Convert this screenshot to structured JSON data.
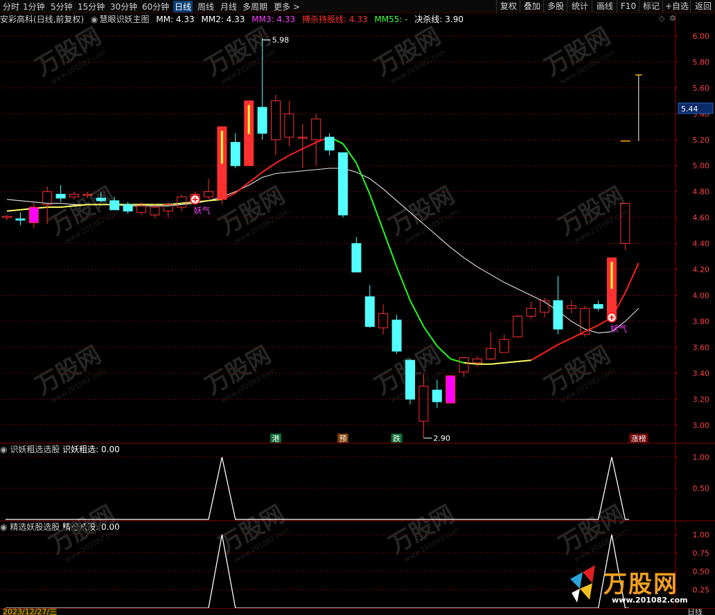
{
  "toolbar": {
    "periods": [
      "分时",
      "1分钟",
      "5分钟",
      "15分钟",
      "30分钟",
      "60分钟",
      "日线",
      "周线",
      "月线",
      "多周期",
      "更多"
    ],
    "active_period": "日线",
    "more_arrow": ">",
    "right_buttons": [
      "复权",
      "叠加",
      "多股",
      "统计",
      "画线",
      "F10",
      "标记",
      "+自选",
      "返回"
    ]
  },
  "info": {
    "stock": "安彩高科",
    "mode": "(日线,前复权)",
    "indicator": "慧眼识妖主图",
    "mm": "MM: 4.33",
    "mm2": "MM2: 4.33",
    "mm3": "MM3: 4.33",
    "hold": "搏杀持股线: 4.33",
    "mm55": "MM55: -",
    "kill": "决杀线: 3.90"
  },
  "colors": {
    "up": "#ff3030",
    "down": "#54ffff",
    "magenta": "#ff00ff",
    "grid": "#7a0000",
    "axis": "#8b0000"
  },
  "chart_data": [
    {
      "type": "candlestick",
      "title": "慧眼识妖主图",
      "ylim": [
        2.86,
        6.08
      ],
      "yticks": [
        "6.00",
        "5.80",
        "5.60",
        "5.40",
        "5.20",
        "5.00",
        "4.80",
        "4.60",
        "4.40",
        "4.20",
        "4.00",
        "3.80",
        "3.60",
        "3.40",
        "3.20",
        "3.00"
      ],
      "current_price": "5.44",
      "candles": [
        {
          "o": 4.6,
          "h": 4.62,
          "l": 4.58,
          "c": 4.61,
          "t": "up"
        },
        {
          "o": 4.59,
          "h": 4.64,
          "l": 4.54,
          "c": 4.58,
          "t": "down"
        },
        {
          "o": 4.56,
          "h": 4.72,
          "l": 4.52,
          "c": 4.68,
          "t": "mag"
        },
        {
          "o": 4.7,
          "h": 4.84,
          "l": 4.55,
          "c": 4.8,
          "t": "up"
        },
        {
          "o": 4.75,
          "h": 4.85,
          "l": 4.72,
          "c": 4.78,
          "t": "down"
        },
        {
          "o": 4.76,
          "h": 4.8,
          "l": 4.74,
          "c": 4.78,
          "t": "up"
        },
        {
          "o": 4.77,
          "h": 4.8,
          "l": 4.75,
          "c": 4.78,
          "t": "up"
        },
        {
          "o": 4.75,
          "h": 4.8,
          "l": 4.72,
          "c": 4.73,
          "t": "down"
        },
        {
          "o": 4.73,
          "h": 4.76,
          "l": 4.68,
          "c": 4.66,
          "t": "down"
        },
        {
          "o": 4.7,
          "h": 4.72,
          "l": 4.63,
          "c": 4.65,
          "t": "down"
        },
        {
          "o": 4.64,
          "h": 4.72,
          "l": 4.62,
          "c": 4.69,
          "t": "up"
        },
        {
          "o": 4.62,
          "h": 4.7,
          "l": 4.6,
          "c": 4.68,
          "t": "up"
        },
        {
          "o": 4.65,
          "h": 4.72,
          "l": 4.6,
          "c": 4.7,
          "t": "up"
        },
        {
          "o": 4.68,
          "h": 4.78,
          "l": 4.65,
          "c": 4.76,
          "t": "up"
        },
        {
          "o": 4.73,
          "h": 4.8,
          "l": 4.7,
          "c": 4.78,
          "t": "up"
        },
        {
          "o": 4.76,
          "h": 4.9,
          "l": 4.74,
          "c": 4.8,
          "t": "up"
        },
        {
          "o": 4.74,
          "h": 5.3,
          "l": 4.7,
          "c": 5.3,
          "t": "up"
        },
        {
          "o": 5.18,
          "h": 5.25,
          "l": 4.98,
          "c": 5.0,
          "t": "down"
        },
        {
          "o": 5.0,
          "h": 5.5,
          "l": 5.0,
          "c": 5.5,
          "t": "up"
        },
        {
          "o": 5.25,
          "h": 5.98,
          "l": 5.2,
          "c": 5.45,
          "t": "down"
        },
        {
          "o": 5.2,
          "h": 5.55,
          "l": 5.08,
          "c": 5.5,
          "t": "up"
        },
        {
          "o": 5.22,
          "h": 5.5,
          "l": 5.15,
          "c": 5.4,
          "t": "up"
        },
        {
          "o": 5.22,
          "h": 5.32,
          "l": 4.98,
          "c": 5.22,
          "t": "up"
        },
        {
          "o": 5.2,
          "h": 5.4,
          "l": 5.0,
          "c": 5.36,
          "t": "up"
        },
        {
          "o": 5.22,
          "h": 5.25,
          "l": 5.08,
          "c": 5.12,
          "t": "down"
        },
        {
          "o": 5.1,
          "h": 5.1,
          "l": 4.6,
          "c": 4.62,
          "t": "down"
        },
        {
          "o": 4.4,
          "h": 4.45,
          "l": 4.18,
          "c": 4.18,
          "t": "down"
        },
        {
          "o": 3.99,
          "h": 4.08,
          "l": 3.75,
          "c": 3.76,
          "t": "down"
        },
        {
          "o": 3.75,
          "h": 3.93,
          "l": 3.7,
          "c": 3.86,
          "t": "up"
        },
        {
          "o": 3.81,
          "h": 3.85,
          "l": 3.55,
          "c": 3.57,
          "t": "down"
        },
        {
          "o": 3.5,
          "h": 3.51,
          "l": 3.16,
          "c": 3.2,
          "t": "down"
        },
        {
          "o": 3.03,
          "h": 3.4,
          "l": 2.9,
          "c": 3.3,
          "t": "up"
        },
        {
          "o": 3.27,
          "h": 3.35,
          "l": 3.13,
          "c": 3.18,
          "t": "down"
        },
        {
          "o": 3.17,
          "h": 3.38,
          "l": 3.17,
          "c": 3.38,
          "t": "mag"
        },
        {
          "o": 3.41,
          "h": 3.52,
          "l": 3.37,
          "c": 3.52,
          "t": "up"
        },
        {
          "o": 3.48,
          "h": 3.53,
          "l": 3.45,
          "c": 3.51,
          "t": "up"
        },
        {
          "o": 3.51,
          "h": 3.72,
          "l": 3.5,
          "c": 3.59,
          "t": "up"
        },
        {
          "o": 3.56,
          "h": 3.7,
          "l": 3.56,
          "c": 3.66,
          "t": "up"
        },
        {
          "o": 3.68,
          "h": 3.85,
          "l": 3.68,
          "c": 3.84,
          "t": "up"
        },
        {
          "o": 3.84,
          "h": 3.95,
          "l": 3.82,
          "c": 3.9,
          "t": "up"
        },
        {
          "o": 3.87,
          "h": 3.98,
          "l": 3.83,
          "c": 3.96,
          "t": "up"
        },
        {
          "o": 3.96,
          "h": 4.15,
          "l": 3.7,
          "c": 3.74,
          "t": "down"
        },
        {
          "o": 3.9,
          "h": 3.96,
          "l": 3.86,
          "c": 3.92,
          "t": "up"
        },
        {
          "o": 3.7,
          "h": 3.92,
          "l": 3.68,
          "c": 3.9,
          "t": "up"
        },
        {
          "o": 3.93,
          "h": 3.96,
          "l": 3.88,
          "c": 3.9,
          "t": "down"
        },
        {
          "o": 3.83,
          "h": 4.29,
          "l": 3.83,
          "c": 4.29,
          "t": "up"
        },
        {
          "o": 4.4,
          "h": 4.71,
          "l": 4.35,
          "c": 4.71,
          "t": "up"
        }
      ],
      "last_high": 5.7,
      "last_mark": 5.19,
      "hold_line": [
        4.65,
        4.66,
        4.67,
        4.68,
        4.68,
        4.69,
        4.7,
        4.7,
        4.7,
        4.7,
        4.7,
        4.7,
        4.7,
        4.71,
        4.72,
        4.73,
        4.74,
        4.79,
        4.87,
        4.95,
        5.02,
        5.08,
        5.13,
        5.18,
        5.22,
        5.17,
        5.02,
        4.78,
        4.5,
        4.22,
        3.96,
        3.76,
        3.61,
        3.51,
        3.48,
        3.47,
        3.47,
        3.48,
        3.49,
        3.5,
        3.56,
        3.62,
        3.67,
        3.72,
        3.77,
        3.83,
        4.02,
        4.25
      ],
      "kill_line": [
        4.74,
        4.73,
        4.72,
        4.71,
        4.71,
        4.7,
        4.7,
        4.7,
        4.7,
        4.69,
        4.69,
        4.69,
        4.69,
        4.7,
        4.71,
        4.73,
        4.76,
        4.8,
        4.85,
        4.91,
        4.94,
        4.95,
        4.96,
        4.97,
        4.98,
        4.98,
        4.95,
        4.9,
        4.82,
        4.73,
        4.64,
        4.55,
        4.46,
        4.37,
        4.29,
        4.22,
        4.16,
        4.1,
        4.05,
        4.0,
        3.95,
        3.88,
        3.8,
        3.74,
        3.71,
        3.72,
        3.8,
        3.9
      ],
      "yao_labels": [
        {
          "i": 14,
          "p": 4.74,
          "text": "妖气"
        },
        {
          "i": 45,
          "p": 3.83,
          "text": "妖气"
        }
      ],
      "price_annotations": [
        {
          "i": 19,
          "p": 5.98,
          "text": "5.98"
        },
        {
          "i": 31,
          "p": 2.9,
          "text": "2.90"
        }
      ],
      "bottom_tags": [
        {
          "i": 20,
          "text": "港",
          "bg": "#0d6b35",
          "fg": "#ffffff"
        },
        {
          "i": 25,
          "text": "预",
          "bg": "#7a3a00",
          "fg": "#ffffff"
        },
        {
          "i": 29,
          "text": "跌",
          "bg": "#0d6b35",
          "fg": "#ffffff"
        },
        {
          "i": 47,
          "text": "涨榜",
          "bg": "#6b0000",
          "fg": "#ffffff"
        }
      ]
    },
    {
      "type": "line",
      "title": "识妖粗选选股",
      "series": [
        {
          "name": "识妖粗选",
          "values": [
            0,
            0,
            0,
            0,
            0,
            0,
            0,
            0,
            0,
            0,
            0,
            0,
            0,
            0,
            0,
            0,
            1,
            0,
            0,
            0,
            0,
            0,
            0,
            0,
            0,
            0,
            0,
            0,
            0,
            0,
            0,
            0,
            0,
            0,
            0,
            0,
            0,
            0,
            0,
            0,
            0,
            0,
            0,
            0,
            0,
            1,
            0,
            0
          ]
        }
      ],
      "value_label": "识妖粗选: 0.00",
      "yticks": [
        "1.00",
        "0.50"
      ],
      "ylim": [
        0,
        1.0
      ]
    },
    {
      "type": "line",
      "title": "精选妖股选股",
      "series": [
        {
          "name": "精选妖股",
          "values": [
            0,
            0,
            0,
            0,
            0,
            0,
            0,
            0,
            0,
            0,
            0,
            0,
            0,
            0,
            0,
            0,
            1,
            0,
            0,
            0,
            0,
            0,
            0,
            0,
            0,
            0,
            0,
            0,
            0,
            0,
            0,
            0,
            0,
            0,
            0,
            0,
            0,
            0,
            0,
            0,
            0,
            0,
            0,
            0,
            0,
            1,
            0,
            0
          ]
        }
      ],
      "value_label": "精选妖股: 0.00",
      "yticks": [
        "1.00",
        "0.75",
        "0.50",
        "0.25"
      ],
      "ylim": [
        0,
        1.0
      ]
    }
  ],
  "watermark": {
    "brand": "万股网",
    "url": "www.201082.com"
  },
  "status": {
    "date": "2023/12/27/三",
    "period": "日线"
  }
}
